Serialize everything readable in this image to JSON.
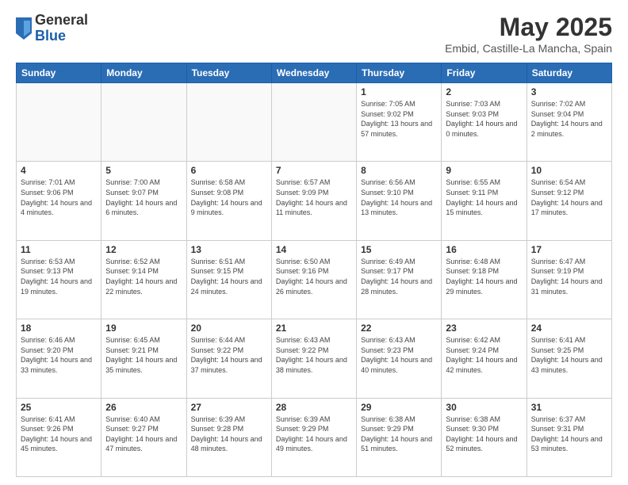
{
  "logo": {
    "general": "General",
    "blue": "Blue"
  },
  "title": "May 2025",
  "subtitle": "Embid, Castille-La Mancha, Spain",
  "days_of_week": [
    "Sunday",
    "Monday",
    "Tuesday",
    "Wednesday",
    "Thursday",
    "Friday",
    "Saturday"
  ],
  "weeks": [
    [
      {
        "day": "",
        "info": ""
      },
      {
        "day": "",
        "info": ""
      },
      {
        "day": "",
        "info": ""
      },
      {
        "day": "",
        "info": ""
      },
      {
        "day": "1",
        "sunrise": "Sunrise: 7:05 AM",
        "sunset": "Sunset: 9:02 PM",
        "daylight": "Daylight: 13 hours and 57 minutes."
      },
      {
        "day": "2",
        "sunrise": "Sunrise: 7:03 AM",
        "sunset": "Sunset: 9:03 PM",
        "daylight": "Daylight: 14 hours and 0 minutes."
      },
      {
        "day": "3",
        "sunrise": "Sunrise: 7:02 AM",
        "sunset": "Sunset: 9:04 PM",
        "daylight": "Daylight: 14 hours and 2 minutes."
      }
    ],
    [
      {
        "day": "4",
        "sunrise": "Sunrise: 7:01 AM",
        "sunset": "Sunset: 9:06 PM",
        "daylight": "Daylight: 14 hours and 4 minutes."
      },
      {
        "day": "5",
        "sunrise": "Sunrise: 7:00 AM",
        "sunset": "Sunset: 9:07 PM",
        "daylight": "Daylight: 14 hours and 6 minutes."
      },
      {
        "day": "6",
        "sunrise": "Sunrise: 6:58 AM",
        "sunset": "Sunset: 9:08 PM",
        "daylight": "Daylight: 14 hours and 9 minutes."
      },
      {
        "day": "7",
        "sunrise": "Sunrise: 6:57 AM",
        "sunset": "Sunset: 9:09 PM",
        "daylight": "Daylight: 14 hours and 11 minutes."
      },
      {
        "day": "8",
        "sunrise": "Sunrise: 6:56 AM",
        "sunset": "Sunset: 9:10 PM",
        "daylight": "Daylight: 14 hours and 13 minutes."
      },
      {
        "day": "9",
        "sunrise": "Sunrise: 6:55 AM",
        "sunset": "Sunset: 9:11 PM",
        "daylight": "Daylight: 14 hours and 15 minutes."
      },
      {
        "day": "10",
        "sunrise": "Sunrise: 6:54 AM",
        "sunset": "Sunset: 9:12 PM",
        "daylight": "Daylight: 14 hours and 17 minutes."
      }
    ],
    [
      {
        "day": "11",
        "sunrise": "Sunrise: 6:53 AM",
        "sunset": "Sunset: 9:13 PM",
        "daylight": "Daylight: 14 hours and 19 minutes."
      },
      {
        "day": "12",
        "sunrise": "Sunrise: 6:52 AM",
        "sunset": "Sunset: 9:14 PM",
        "daylight": "Daylight: 14 hours and 22 minutes."
      },
      {
        "day": "13",
        "sunrise": "Sunrise: 6:51 AM",
        "sunset": "Sunset: 9:15 PM",
        "daylight": "Daylight: 14 hours and 24 minutes."
      },
      {
        "day": "14",
        "sunrise": "Sunrise: 6:50 AM",
        "sunset": "Sunset: 9:16 PM",
        "daylight": "Daylight: 14 hours and 26 minutes."
      },
      {
        "day": "15",
        "sunrise": "Sunrise: 6:49 AM",
        "sunset": "Sunset: 9:17 PM",
        "daylight": "Daylight: 14 hours and 28 minutes."
      },
      {
        "day": "16",
        "sunrise": "Sunrise: 6:48 AM",
        "sunset": "Sunset: 9:18 PM",
        "daylight": "Daylight: 14 hours and 29 minutes."
      },
      {
        "day": "17",
        "sunrise": "Sunrise: 6:47 AM",
        "sunset": "Sunset: 9:19 PM",
        "daylight": "Daylight: 14 hours and 31 minutes."
      }
    ],
    [
      {
        "day": "18",
        "sunrise": "Sunrise: 6:46 AM",
        "sunset": "Sunset: 9:20 PM",
        "daylight": "Daylight: 14 hours and 33 minutes."
      },
      {
        "day": "19",
        "sunrise": "Sunrise: 6:45 AM",
        "sunset": "Sunset: 9:21 PM",
        "daylight": "Daylight: 14 hours and 35 minutes."
      },
      {
        "day": "20",
        "sunrise": "Sunrise: 6:44 AM",
        "sunset": "Sunset: 9:22 PM",
        "daylight": "Daylight: 14 hours and 37 minutes."
      },
      {
        "day": "21",
        "sunrise": "Sunrise: 6:43 AM",
        "sunset": "Sunset: 9:22 PM",
        "daylight": "Daylight: 14 hours and 38 minutes."
      },
      {
        "day": "22",
        "sunrise": "Sunrise: 6:43 AM",
        "sunset": "Sunset: 9:23 PM",
        "daylight": "Daylight: 14 hours and 40 minutes."
      },
      {
        "day": "23",
        "sunrise": "Sunrise: 6:42 AM",
        "sunset": "Sunset: 9:24 PM",
        "daylight": "Daylight: 14 hours and 42 minutes."
      },
      {
        "day": "24",
        "sunrise": "Sunrise: 6:41 AM",
        "sunset": "Sunset: 9:25 PM",
        "daylight": "Daylight: 14 hours and 43 minutes."
      }
    ],
    [
      {
        "day": "25",
        "sunrise": "Sunrise: 6:41 AM",
        "sunset": "Sunset: 9:26 PM",
        "daylight": "Daylight: 14 hours and 45 minutes."
      },
      {
        "day": "26",
        "sunrise": "Sunrise: 6:40 AM",
        "sunset": "Sunset: 9:27 PM",
        "daylight": "Daylight: 14 hours and 47 minutes."
      },
      {
        "day": "27",
        "sunrise": "Sunrise: 6:39 AM",
        "sunset": "Sunset: 9:28 PM",
        "daylight": "Daylight: 14 hours and 48 minutes."
      },
      {
        "day": "28",
        "sunrise": "Sunrise: 6:39 AM",
        "sunset": "Sunset: 9:29 PM",
        "daylight": "Daylight: 14 hours and 49 minutes."
      },
      {
        "day": "29",
        "sunrise": "Sunrise: 6:38 AM",
        "sunset": "Sunset: 9:29 PM",
        "daylight": "Daylight: 14 hours and 51 minutes."
      },
      {
        "day": "30",
        "sunrise": "Sunrise: 6:38 AM",
        "sunset": "Sunset: 9:30 PM",
        "daylight": "Daylight: 14 hours and 52 minutes."
      },
      {
        "day": "31",
        "sunrise": "Sunrise: 6:37 AM",
        "sunset": "Sunset: 9:31 PM",
        "daylight": "Daylight: 14 hours and 53 minutes."
      }
    ]
  ]
}
